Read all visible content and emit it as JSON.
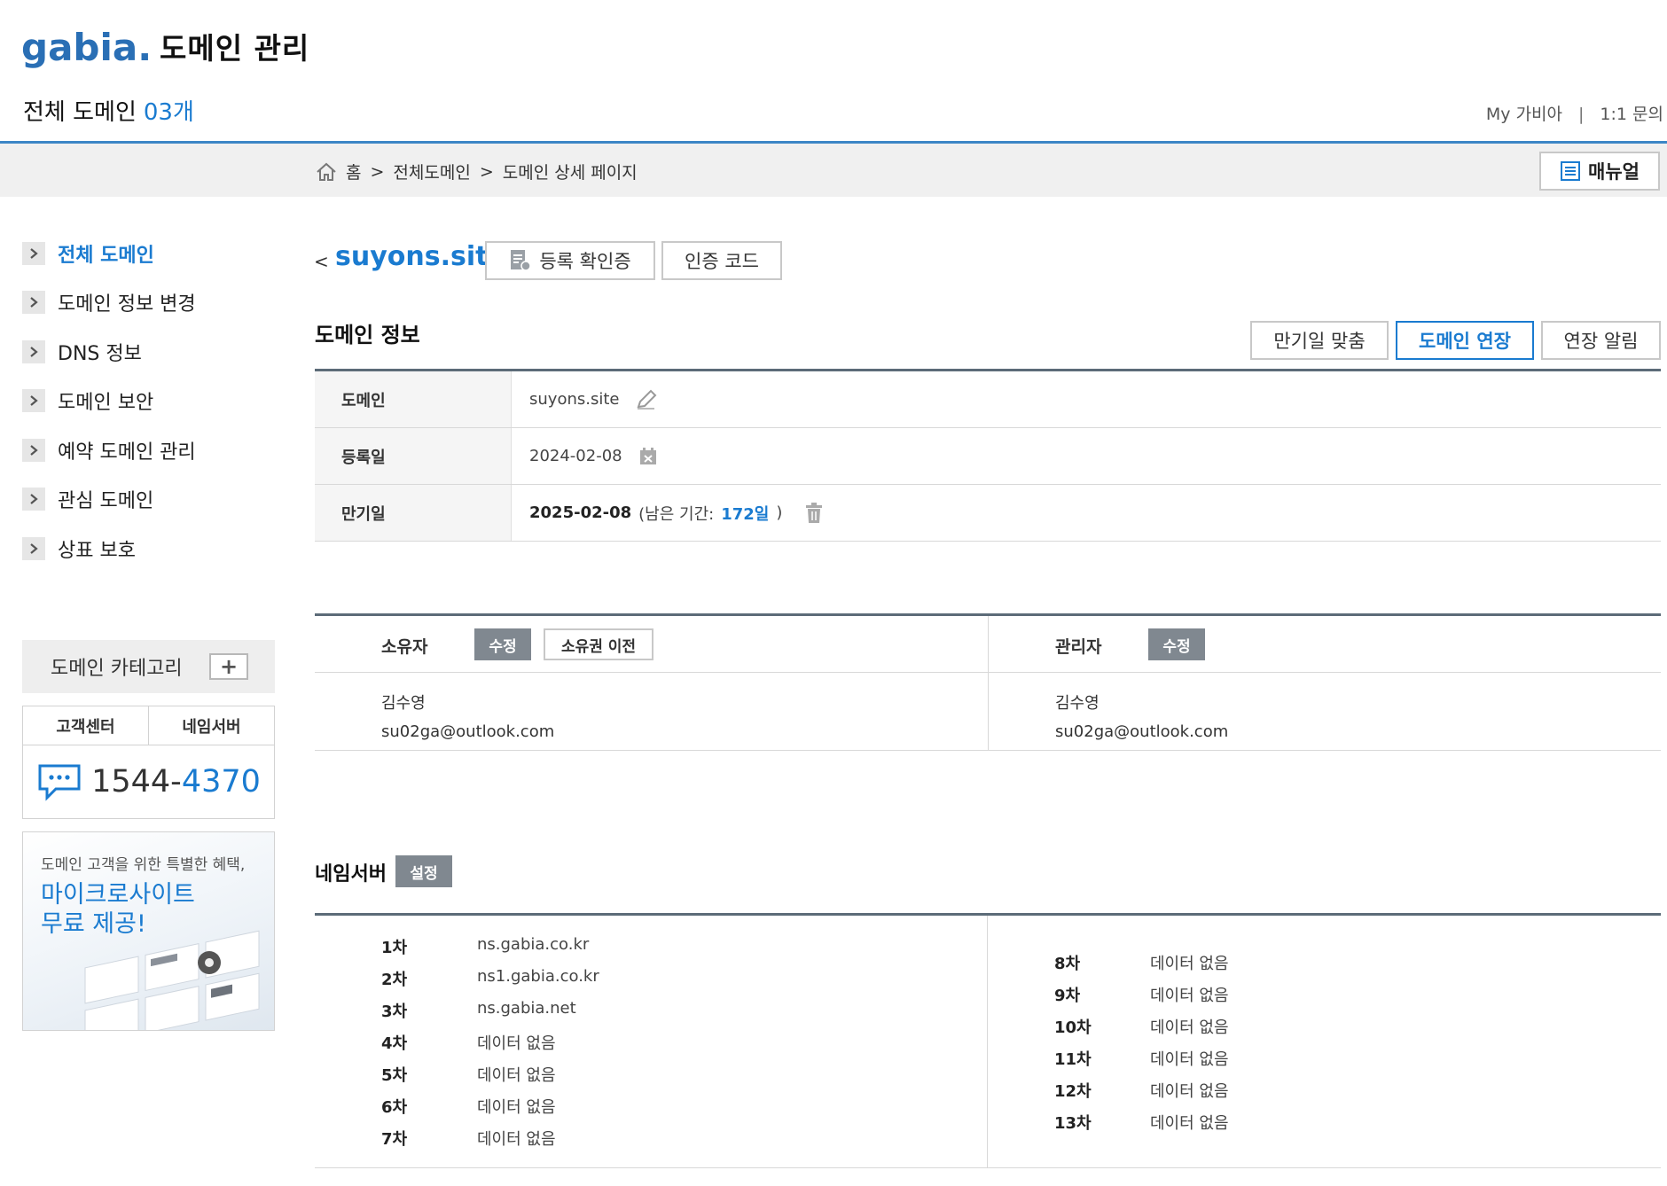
{
  "header": {
    "logo_text": "gabia.",
    "app_title": "도메인 관리",
    "all_domains_label": "전체 도메인",
    "all_domains_count": "03개",
    "top_links": [
      "My 가비아",
      "1:1 문의"
    ],
    "top_links_separator": "|"
  },
  "breadcrumb": {
    "items": [
      "홈",
      "전체도메인",
      "도메인 상세 페이지"
    ],
    "separator": ">",
    "manual_button": "매뉴얼"
  },
  "sidebar": {
    "items": [
      {
        "label": "전체 도메인",
        "active": true
      },
      {
        "label": "도메인 정보 변경",
        "active": false
      },
      {
        "label": "DNS 정보",
        "active": false
      },
      {
        "label": "도메인 보안",
        "active": false
      },
      {
        "label": "예약 도메인 관리",
        "active": false
      },
      {
        "label": "관심 도메인",
        "active": false
      },
      {
        "label": "상표 보호",
        "active": false
      }
    ],
    "category_label": "도메인 카테고리",
    "category_plus": "+",
    "cs_tabs": [
      "고객센터",
      "네임서버"
    ],
    "phone_prefix": "1544-",
    "phone_suffix": "4370",
    "promo_line1": "도메인 고객을 위한 특별한 혜택,",
    "promo_line2": "마이크로사이트",
    "promo_line3": "무료 제공!"
  },
  "domain": {
    "back_glyph": "<",
    "name": "suyons.site",
    "btn_certificate": "등록 확인증",
    "btn_auth_code": "인증 코드"
  },
  "info": {
    "section_title": "도메인 정보",
    "btn_match_expiry": "만기일 맞춤",
    "btn_extend": "도메인 연장",
    "btn_extend_alert": "연장 알림",
    "rows": {
      "domain_label": "도메인",
      "domain_value": "suyons.site",
      "reg_label": "등록일",
      "reg_value": "2024-02-08",
      "exp_label": "만기일",
      "exp_value": "2025-02-08",
      "remaining_prefix": "(남은 기간:",
      "remaining_days": "172일",
      "remaining_suffix": ")"
    }
  },
  "contacts": {
    "owner_title": "소유자",
    "owner_edit": "수정",
    "owner_transfer": "소유권 이전",
    "owner_name": "김수영",
    "owner_email": "su02ga@outlook.com",
    "admin_title": "관리자",
    "admin_edit": "수정",
    "admin_name": "김수영",
    "admin_email": "su02ga@outlook.com"
  },
  "nameservers": {
    "title": "네임서버",
    "set_button": "설정",
    "left": [
      {
        "k": "1차",
        "v": "ns.gabia.co.kr"
      },
      {
        "k": "2차",
        "v": "ns1.gabia.co.kr"
      },
      {
        "k": "3차",
        "v": "ns.gabia.net"
      },
      {
        "k": "4차",
        "v": "데이터 없음"
      },
      {
        "k": "5차",
        "v": "데이터 없음"
      },
      {
        "k": "6차",
        "v": "데이터 없음"
      },
      {
        "k": "7차",
        "v": "데이터 없음"
      }
    ],
    "right": [
      {
        "k": "8차",
        "v": "데이터 없음"
      },
      {
        "k": "9차",
        "v": "데이터 없음"
      },
      {
        "k": "10차",
        "v": "데이터 없음"
      },
      {
        "k": "11차",
        "v": "데이터 없음"
      },
      {
        "k": "12차",
        "v": "데이터 없음"
      },
      {
        "k": "13차",
        "v": "데이터 없음"
      }
    ]
  },
  "colors": {
    "accent": "#1a7bd0",
    "divider": "#5c6b78",
    "gray_button": "#808890"
  }
}
